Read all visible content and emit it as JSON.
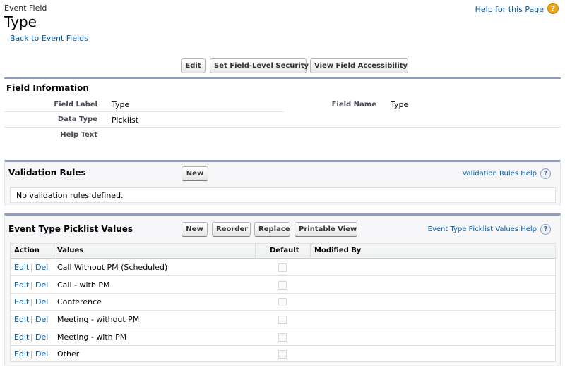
{
  "header": {
    "object_type": "Event Field",
    "title": "Type",
    "back_link": "Back to Event Fields",
    "help_link": "Help for this Page",
    "help_icon": "?"
  },
  "toolbar": {
    "edit_label": "Edit",
    "fls_label": "Set Field-Level Security",
    "accessibility_label": "View Field Accessibility"
  },
  "field_info": {
    "title": "Field Information",
    "field_label_label": "Field Label",
    "field_label_value": "Type",
    "data_type_label": "Data Type",
    "data_type_value": "Picklist",
    "help_text_label": "Help Text",
    "help_text_value": "",
    "field_name_label": "Field Name",
    "field_name_value": "Type"
  },
  "validation_rules": {
    "title": "Validation Rules",
    "new_label": "New",
    "help_link": "Validation Rules Help",
    "help_icon": "?",
    "empty_text": "No validation rules defined."
  },
  "picklist": {
    "title": "Event Type Picklist Values",
    "new_label": "New",
    "reorder_label": "Reorder",
    "replace_label": "Replace",
    "printable_label": "Printable View",
    "help_link": "Event Type Picklist Values Help",
    "help_icon": "?",
    "columns": {
      "action": "Action",
      "values": "Values",
      "default": "Default",
      "modified_by": "Modified By"
    },
    "edit_label": "Edit",
    "del_label": "Del",
    "action_sep": "|",
    "rows": [
      {
        "value": "Call Without PM (Scheduled)",
        "default": false,
        "modified_by": ""
      },
      {
        "value": "Call - with PM",
        "default": false,
        "modified_by": ""
      },
      {
        "value": "Conference",
        "default": false,
        "modified_by": ""
      },
      {
        "value": "Meeting - without PM",
        "default": false,
        "modified_by": ""
      },
      {
        "value": "Meeting - with PM",
        "default": false,
        "modified_by": ""
      },
      {
        "value": "Other",
        "default": false,
        "modified_by": ""
      }
    ]
  },
  "colors": {
    "link": "#015ba7",
    "section_rule": "#8e9dbe",
    "help_orange": "#e8a317",
    "list_background": "#f7f6f9"
  }
}
